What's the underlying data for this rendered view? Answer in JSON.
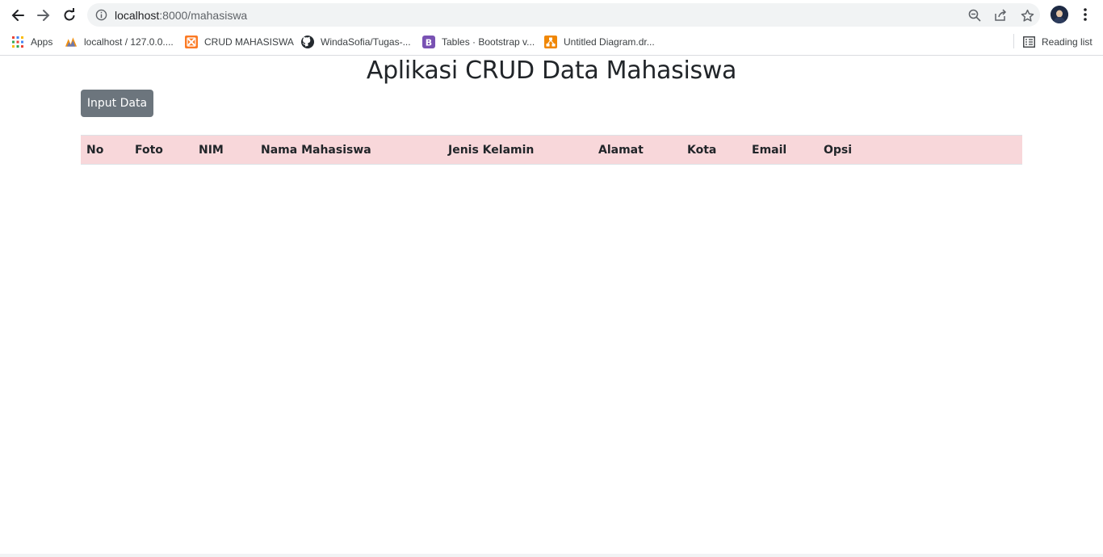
{
  "browser": {
    "url_host": "localhost",
    "url_path": ":8000/mahasiswa",
    "reading_list_label": "Reading list",
    "bookmarks": [
      {
        "label": "Apps",
        "icon": "apps-grid-icon"
      },
      {
        "label": "localhost / 127.0.0....",
        "icon": "phpmyadmin-icon"
      },
      {
        "label": "CRUD MAHASISWA",
        "icon": "xampp-icon"
      },
      {
        "label": "WindaSofia/Tugas-...",
        "icon": "github-icon"
      },
      {
        "label": "Tables · Bootstrap v...",
        "icon": "bootstrap-icon"
      },
      {
        "label": "Untitled Diagram.dr...",
        "icon": "drawio-icon"
      }
    ]
  },
  "page": {
    "title": "Aplikasi CRUD Data Mahasiswa",
    "input_button_label": "Input Data"
  },
  "table": {
    "headers": [
      "No",
      "Foto",
      "NIM",
      "Nama Mahasiswa",
      "Jenis Kelamin",
      "Alamat",
      "Kota",
      "Email",
      "Opsi"
    ],
    "header_background": "#f8d7da"
  },
  "colors": {
    "button_secondary": "#6c757d",
    "text": "#212529"
  }
}
